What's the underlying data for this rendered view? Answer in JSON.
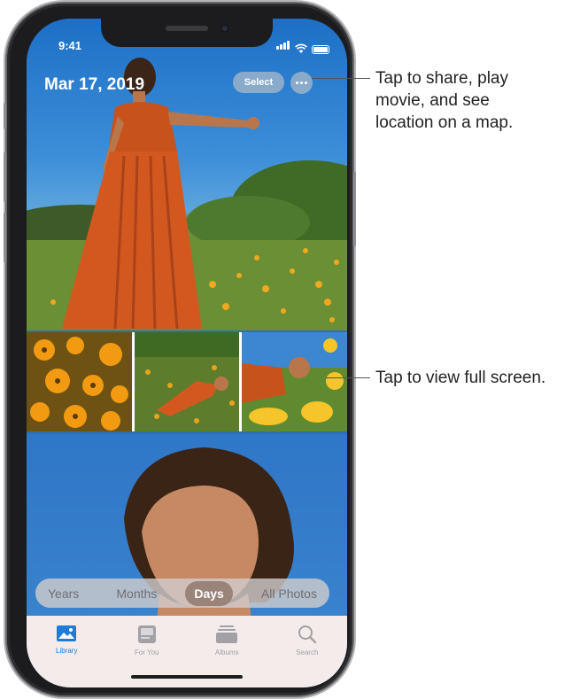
{
  "status_bar": {
    "time": "9:41"
  },
  "header": {
    "date": "Mar 17, 2019",
    "select_label": "Select"
  },
  "segmented_control": {
    "items": [
      {
        "label": "Years",
        "active": false
      },
      {
        "label": "Months",
        "active": false
      },
      {
        "label": "Days",
        "active": true
      },
      {
        "label": "All Photos",
        "active": false
      }
    ]
  },
  "tab_bar": {
    "tabs": [
      {
        "label": "Library",
        "icon": "library-icon",
        "active": true
      },
      {
        "label": "For You",
        "icon": "for-you-icon",
        "active": false
      },
      {
        "label": "Albums",
        "icon": "albums-icon",
        "active": false
      },
      {
        "label": "Search",
        "icon": "search-icon",
        "active": false
      }
    ]
  },
  "callouts": {
    "top": [
      "Tap to share, play",
      "movie, and see",
      "location on a map."
    ],
    "middle": "Tap to view full screen."
  },
  "colors": {
    "accent": "#1e7bd9",
    "active_segment": "#9a8378",
    "sky": "#2b6fb4"
  }
}
